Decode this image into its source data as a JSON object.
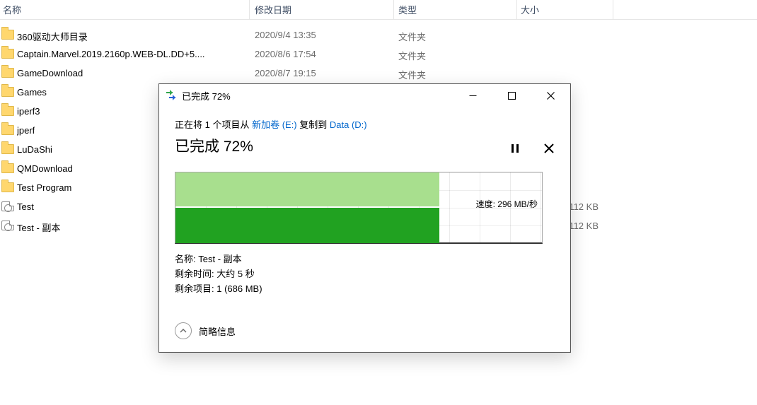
{
  "columns": {
    "name": "名称",
    "date": "修改日期",
    "type": "类型",
    "size": "大小"
  },
  "rows": [
    {
      "icon": "folder",
      "name": "360驱动大师目录",
      "date": "2020/9/4 13:35",
      "type": "文件夹",
      "size": ""
    },
    {
      "icon": "folder",
      "name": "Captain.Marvel.2019.2160p.WEB-DL.DD+5....",
      "date": "2020/8/6 17:54",
      "type": "文件夹",
      "size": ""
    },
    {
      "icon": "folder",
      "name": "GameDownload",
      "date": "2020/8/7 19:15",
      "type": "文件夹",
      "size": ""
    },
    {
      "icon": "folder",
      "name": "Games",
      "date": "",
      "type": "",
      "size": ""
    },
    {
      "icon": "folder",
      "name": "iperf3",
      "date": "",
      "type": "",
      "size": ""
    },
    {
      "icon": "folder",
      "name": "jperf",
      "date": "",
      "type": "",
      "size": ""
    },
    {
      "icon": "folder",
      "name": "LuDaShi",
      "date": "",
      "type": "",
      "size": ""
    },
    {
      "icon": "folder",
      "name": "QMDownload",
      "date": "",
      "type": "",
      "size": ""
    },
    {
      "icon": "folder",
      "name": "Test Program",
      "date": "",
      "type": "",
      "size": ""
    },
    {
      "icon": "file",
      "name": "Test",
      "date": "",
      "type": "",
      "size": "112 KB"
    },
    {
      "icon": "file",
      "name": "Test - 副本",
      "date": "",
      "type": "",
      "size": "112 KB"
    }
  ],
  "dialog": {
    "title": "已完成 72%",
    "copying_prefix": "正在将 1 个项目从 ",
    "source_link": "新加卷 (E:)",
    "copying_middle": " 复制到 ",
    "dest_link": "Data (D:)",
    "big_status": "已完成 72%",
    "speed_label": "速度: 296 MB/秒",
    "progress_percent": 72,
    "details": {
      "name_label": "名称: ",
      "name_value": "Test - 副本",
      "time_label": "剩余时间: ",
      "time_value": "大约 5 秒",
      "items_label": "剩余项目: ",
      "items_value": "1 (686 MB)"
    },
    "simple_info": "简略信息"
  }
}
